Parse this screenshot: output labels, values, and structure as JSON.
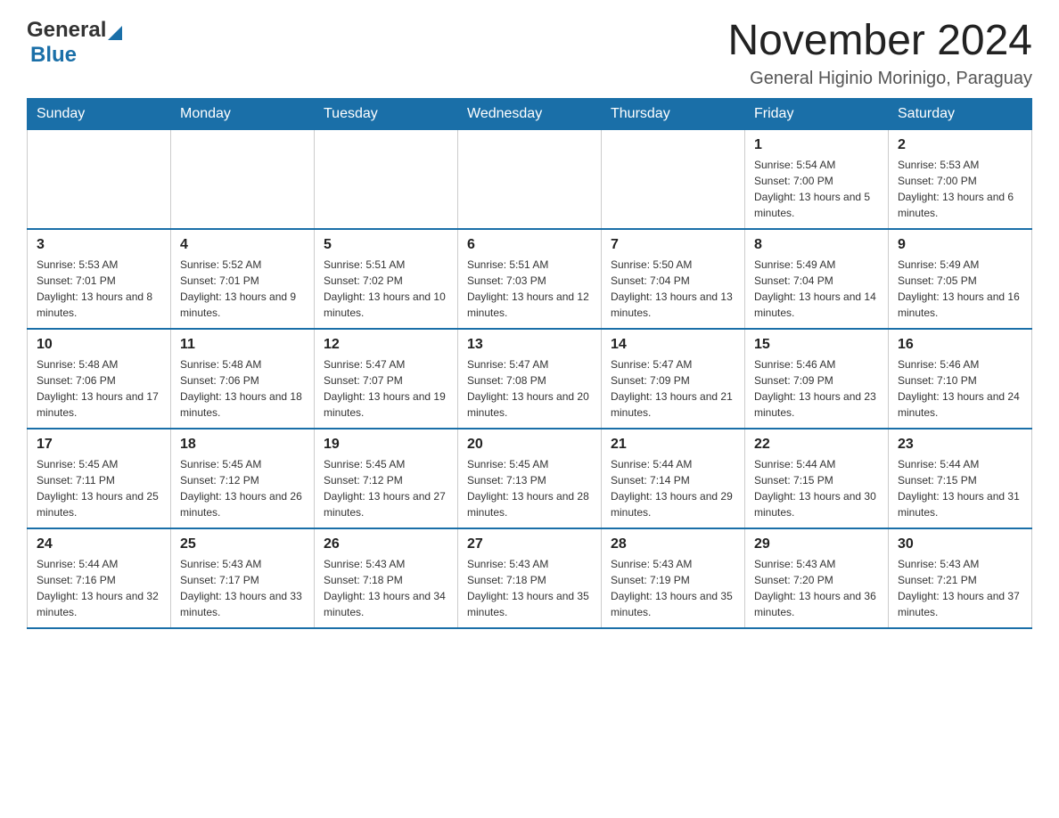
{
  "header": {
    "logo": {
      "line1": "General",
      "line2": "Blue",
      "triangle_alt": "blue triangle"
    },
    "title": "November 2024",
    "subtitle": "General Higinio Morinigo, Paraguay"
  },
  "calendar": {
    "days_of_week": [
      "Sunday",
      "Monday",
      "Tuesday",
      "Wednesday",
      "Thursday",
      "Friday",
      "Saturday"
    ],
    "weeks": [
      [
        {
          "day": "",
          "info": ""
        },
        {
          "day": "",
          "info": ""
        },
        {
          "day": "",
          "info": ""
        },
        {
          "day": "",
          "info": ""
        },
        {
          "day": "",
          "info": ""
        },
        {
          "day": "1",
          "info": "Sunrise: 5:54 AM\nSunset: 7:00 PM\nDaylight: 13 hours and 5 minutes."
        },
        {
          "day": "2",
          "info": "Sunrise: 5:53 AM\nSunset: 7:00 PM\nDaylight: 13 hours and 6 minutes."
        }
      ],
      [
        {
          "day": "3",
          "info": "Sunrise: 5:53 AM\nSunset: 7:01 PM\nDaylight: 13 hours and 8 minutes."
        },
        {
          "day": "4",
          "info": "Sunrise: 5:52 AM\nSunset: 7:01 PM\nDaylight: 13 hours and 9 minutes."
        },
        {
          "day": "5",
          "info": "Sunrise: 5:51 AM\nSunset: 7:02 PM\nDaylight: 13 hours and 10 minutes."
        },
        {
          "day": "6",
          "info": "Sunrise: 5:51 AM\nSunset: 7:03 PM\nDaylight: 13 hours and 12 minutes."
        },
        {
          "day": "7",
          "info": "Sunrise: 5:50 AM\nSunset: 7:04 PM\nDaylight: 13 hours and 13 minutes."
        },
        {
          "day": "8",
          "info": "Sunrise: 5:49 AM\nSunset: 7:04 PM\nDaylight: 13 hours and 14 minutes."
        },
        {
          "day": "9",
          "info": "Sunrise: 5:49 AM\nSunset: 7:05 PM\nDaylight: 13 hours and 16 minutes."
        }
      ],
      [
        {
          "day": "10",
          "info": "Sunrise: 5:48 AM\nSunset: 7:06 PM\nDaylight: 13 hours and 17 minutes."
        },
        {
          "day": "11",
          "info": "Sunrise: 5:48 AM\nSunset: 7:06 PM\nDaylight: 13 hours and 18 minutes."
        },
        {
          "day": "12",
          "info": "Sunrise: 5:47 AM\nSunset: 7:07 PM\nDaylight: 13 hours and 19 minutes."
        },
        {
          "day": "13",
          "info": "Sunrise: 5:47 AM\nSunset: 7:08 PM\nDaylight: 13 hours and 20 minutes."
        },
        {
          "day": "14",
          "info": "Sunrise: 5:47 AM\nSunset: 7:09 PM\nDaylight: 13 hours and 21 minutes."
        },
        {
          "day": "15",
          "info": "Sunrise: 5:46 AM\nSunset: 7:09 PM\nDaylight: 13 hours and 23 minutes."
        },
        {
          "day": "16",
          "info": "Sunrise: 5:46 AM\nSunset: 7:10 PM\nDaylight: 13 hours and 24 minutes."
        }
      ],
      [
        {
          "day": "17",
          "info": "Sunrise: 5:45 AM\nSunset: 7:11 PM\nDaylight: 13 hours and 25 minutes."
        },
        {
          "day": "18",
          "info": "Sunrise: 5:45 AM\nSunset: 7:12 PM\nDaylight: 13 hours and 26 minutes."
        },
        {
          "day": "19",
          "info": "Sunrise: 5:45 AM\nSunset: 7:12 PM\nDaylight: 13 hours and 27 minutes."
        },
        {
          "day": "20",
          "info": "Sunrise: 5:45 AM\nSunset: 7:13 PM\nDaylight: 13 hours and 28 minutes."
        },
        {
          "day": "21",
          "info": "Sunrise: 5:44 AM\nSunset: 7:14 PM\nDaylight: 13 hours and 29 minutes."
        },
        {
          "day": "22",
          "info": "Sunrise: 5:44 AM\nSunset: 7:15 PM\nDaylight: 13 hours and 30 minutes."
        },
        {
          "day": "23",
          "info": "Sunrise: 5:44 AM\nSunset: 7:15 PM\nDaylight: 13 hours and 31 minutes."
        }
      ],
      [
        {
          "day": "24",
          "info": "Sunrise: 5:44 AM\nSunset: 7:16 PM\nDaylight: 13 hours and 32 minutes."
        },
        {
          "day": "25",
          "info": "Sunrise: 5:43 AM\nSunset: 7:17 PM\nDaylight: 13 hours and 33 minutes."
        },
        {
          "day": "26",
          "info": "Sunrise: 5:43 AM\nSunset: 7:18 PM\nDaylight: 13 hours and 34 minutes."
        },
        {
          "day": "27",
          "info": "Sunrise: 5:43 AM\nSunset: 7:18 PM\nDaylight: 13 hours and 35 minutes."
        },
        {
          "day": "28",
          "info": "Sunrise: 5:43 AM\nSunset: 7:19 PM\nDaylight: 13 hours and 35 minutes."
        },
        {
          "day": "29",
          "info": "Sunrise: 5:43 AM\nSunset: 7:20 PM\nDaylight: 13 hours and 36 minutes."
        },
        {
          "day": "30",
          "info": "Sunrise: 5:43 AM\nSunset: 7:21 PM\nDaylight: 13 hours and 37 minutes."
        }
      ]
    ]
  }
}
